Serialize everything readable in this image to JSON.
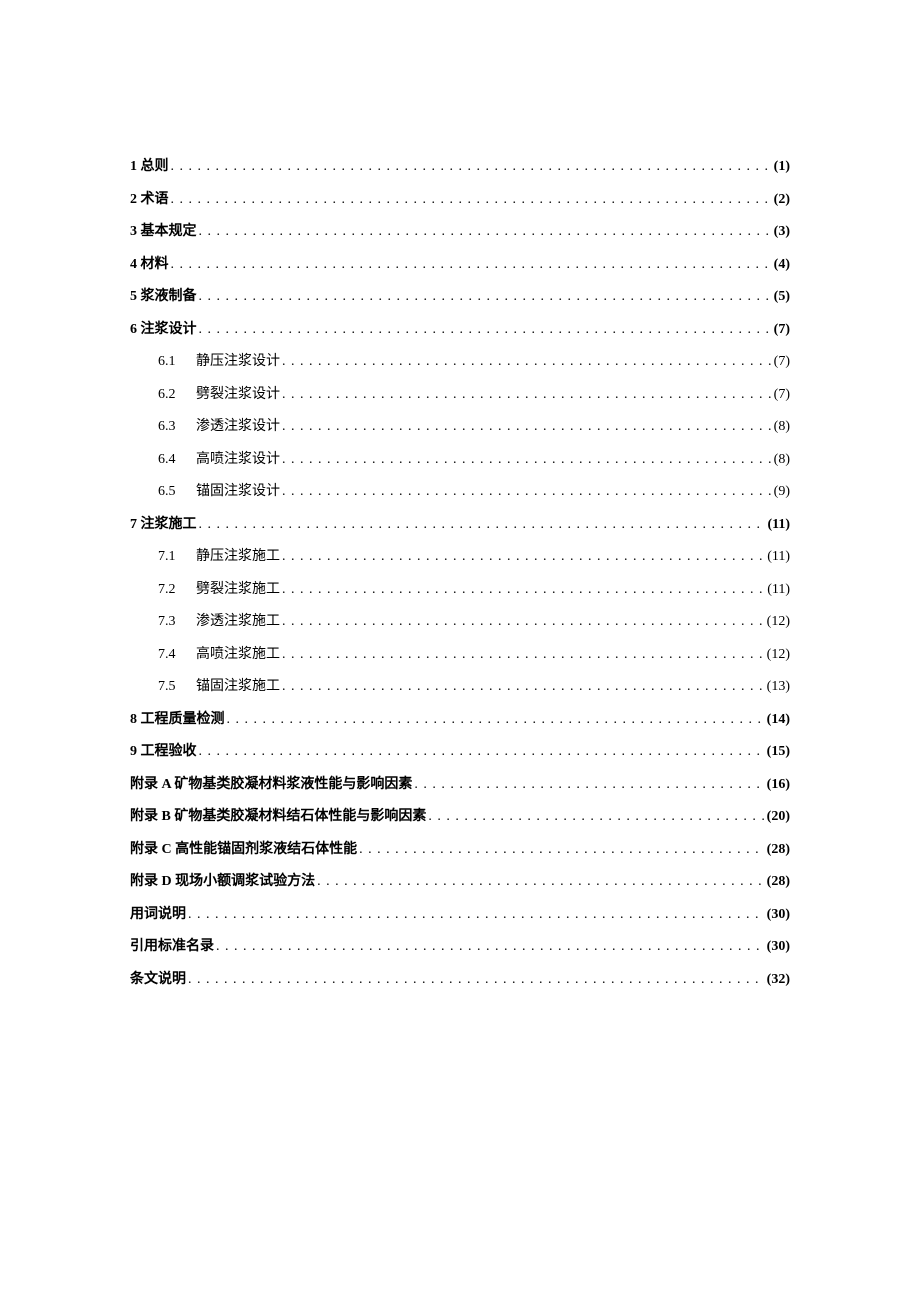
{
  "toc": [
    {
      "level": 0,
      "label": "1 总则",
      "page": "(1)"
    },
    {
      "level": 0,
      "label": "2 术语",
      "page": "(2)"
    },
    {
      "level": 0,
      "label": "3 基本规定",
      "page": "(3)"
    },
    {
      "level": 0,
      "label": "4 材料",
      "page": "(4)"
    },
    {
      "level": 0,
      "label": "5 浆液制备",
      "page": "(5)"
    },
    {
      "level": 0,
      "label": "6 注浆设计",
      "page": "(7)"
    },
    {
      "level": 1,
      "num": "6.1",
      "label": "静压注浆设计",
      "page": "(7)"
    },
    {
      "level": 1,
      "num": "6.2",
      "label": "劈裂注浆设计",
      "page": "(7)"
    },
    {
      "level": 1,
      "num": "6.3",
      "label": "渗透注浆设计",
      "page": "(8)"
    },
    {
      "level": 1,
      "num": "6.4",
      "label": "高喷注浆设计",
      "page": "(8)"
    },
    {
      "level": 1,
      "num": "6.5",
      "label": "锚固注浆设计",
      "page": "(9)"
    },
    {
      "level": 0,
      "label": "7 注浆施工",
      "page": "(11)"
    },
    {
      "level": 1,
      "num": "7.1",
      "label": "静压注浆施工",
      "page": "(11)"
    },
    {
      "level": 1,
      "num": "7.2",
      "label": "劈裂注浆施工",
      "page": "(11)"
    },
    {
      "level": 1,
      "num": "7.3",
      "label": "渗透注浆施工",
      "page": "(12)"
    },
    {
      "level": 1,
      "num": "7.4",
      "label": "高喷注浆施工",
      "page": "(12)"
    },
    {
      "level": 1,
      "num": "7.5",
      "label": "锚固注浆施工",
      "page": "(13)"
    },
    {
      "level": 0,
      "label": "8 工程质量检测",
      "page": "(14)"
    },
    {
      "level": 0,
      "label": "9 工程验收",
      "page": "(15)"
    },
    {
      "level": 0,
      "label": "附录 A 矿物基类胶凝材料浆液性能与影响因素",
      "page": "(16)"
    },
    {
      "level": 0,
      "label": "附录 B 矿物基类胶凝材料结石体性能与影响因素",
      "page": "(20)"
    },
    {
      "level": 0,
      "label": "附录 C 高性能锚固剂浆液结石体性能",
      "page": "(28)"
    },
    {
      "level": 0,
      "label": "附录 D 现场小额调浆试验方法",
      "page": "(28)"
    },
    {
      "level": 0,
      "label": "用词说明",
      "page": "(30)"
    },
    {
      "level": 0,
      "label": "引用标准名录",
      "page": "(30)"
    },
    {
      "level": 0,
      "label": "条文说明",
      "page": "(32)"
    }
  ]
}
